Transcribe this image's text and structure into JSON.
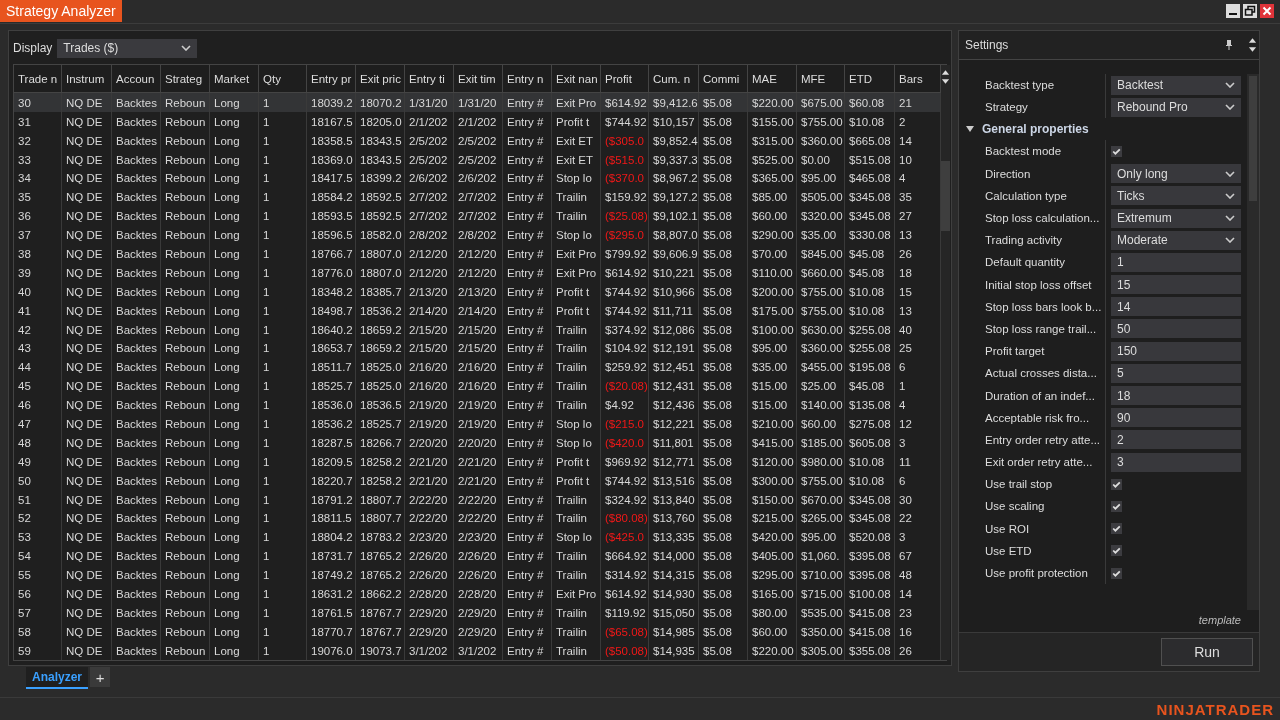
{
  "window": {
    "title": "Strategy Analyzer"
  },
  "display": {
    "label": "Display",
    "value": "Trades ($)"
  },
  "table": {
    "columns": [
      "Trade n",
      "Instrum",
      "Accoun",
      "Strateg",
      "Market",
      "Qty",
      "Entry pr",
      "Exit pric",
      "Entry ti",
      "Exit tim",
      "Entry n",
      "Exit nan",
      "Profit",
      "Cum. n",
      "Commi",
      "MAE",
      "MFE",
      "ETD",
      "Bars"
    ],
    "rows": [
      {
        "selected": true,
        "loss": false,
        "cells": [
          "30",
          "NQ DE",
          "Backtes",
          "Reboun",
          "Long",
          "1",
          "18039.2",
          "18070.2",
          "1/31/20",
          "1/31/20",
          "Entry #",
          "Exit Pro",
          "$614.92",
          "$9,412.6",
          "$5.08",
          "$220.00",
          "$675.00",
          "$60.08",
          "21"
        ]
      },
      {
        "selected": false,
        "loss": false,
        "cells": [
          "31",
          "NQ DE",
          "Backtes",
          "Reboun",
          "Long",
          "1",
          "18167.5",
          "18205.0",
          "2/1/202",
          "2/1/202",
          "Entry #",
          "Profit t",
          "$744.92",
          "$10,157",
          "$5.08",
          "$155.00",
          "$755.00",
          "$10.08",
          "2"
        ]
      },
      {
        "selected": false,
        "loss": true,
        "cells": [
          "32",
          "NQ DE",
          "Backtes",
          "Reboun",
          "Long",
          "1",
          "18358.5",
          "18343.5",
          "2/5/202",
          "2/5/202",
          "Entry #",
          "Exit ET",
          "($305.0",
          "$9,852.4",
          "$5.08",
          "$315.00",
          "$360.00",
          "$665.08",
          "14"
        ]
      },
      {
        "selected": false,
        "loss": true,
        "cells": [
          "33",
          "NQ DE",
          "Backtes",
          "Reboun",
          "Long",
          "1",
          "18369.0",
          "18343.5",
          "2/5/202",
          "2/5/202",
          "Entry #",
          "Exit ET",
          "($515.0",
          "$9,337.3",
          "$5.08",
          "$525.00",
          "$0.00",
          "$515.08",
          "10"
        ]
      },
      {
        "selected": false,
        "loss": true,
        "cells": [
          "34",
          "NQ DE",
          "Backtes",
          "Reboun",
          "Long",
          "1",
          "18417.5",
          "18399.2",
          "2/6/202",
          "2/6/202",
          "Entry #",
          "Stop lo",
          "($370.0",
          "$8,967.2",
          "$5.08",
          "$365.00",
          "$95.00",
          "$465.08",
          "4"
        ]
      },
      {
        "selected": false,
        "loss": false,
        "cells": [
          "35",
          "NQ DE",
          "Backtes",
          "Reboun",
          "Long",
          "1",
          "18584.2",
          "18592.5",
          "2/7/202",
          "2/7/202",
          "Entry #",
          "Trailin",
          "$159.92",
          "$9,127.2",
          "$5.08",
          "$85.00",
          "$505.00",
          "$345.08",
          "35"
        ]
      },
      {
        "selected": false,
        "loss": true,
        "cells": [
          "36",
          "NQ DE",
          "Backtes",
          "Reboun",
          "Long",
          "1",
          "18593.5",
          "18592.5",
          "2/7/202",
          "2/7/202",
          "Entry #",
          "Trailin",
          "($25.08)",
          "$9,102.1",
          "$5.08",
          "$60.00",
          "$320.00",
          "$345.08",
          "27"
        ]
      },
      {
        "selected": false,
        "loss": true,
        "cells": [
          "37",
          "NQ DE",
          "Backtes",
          "Reboun",
          "Long",
          "1",
          "18596.5",
          "18582.0",
          "2/8/202",
          "2/8/202",
          "Entry #",
          "Stop lo",
          "($295.0",
          "$8,807.0",
          "$5.08",
          "$290.00",
          "$35.00",
          "$330.08",
          "13"
        ]
      },
      {
        "selected": false,
        "loss": false,
        "cells": [
          "38",
          "NQ DE",
          "Backtes",
          "Reboun",
          "Long",
          "1",
          "18766.7",
          "18807.0",
          "2/12/20",
          "2/12/20",
          "Entry #",
          "Exit Pro",
          "$799.92",
          "$9,606.9",
          "$5.08",
          "$70.00",
          "$845.00",
          "$45.08",
          "26"
        ]
      },
      {
        "selected": false,
        "loss": false,
        "cells": [
          "39",
          "NQ DE",
          "Backtes",
          "Reboun",
          "Long",
          "1",
          "18776.0",
          "18807.0",
          "2/12/20",
          "2/12/20",
          "Entry #",
          "Exit Pro",
          "$614.92",
          "$10,221",
          "$5.08",
          "$110.00",
          "$660.00",
          "$45.08",
          "18"
        ]
      },
      {
        "selected": false,
        "loss": false,
        "cells": [
          "40",
          "NQ DE",
          "Backtes",
          "Reboun",
          "Long",
          "1",
          "18348.2",
          "18385.7",
          "2/13/20",
          "2/13/20",
          "Entry #",
          "Profit t",
          "$744.92",
          "$10,966",
          "$5.08",
          "$200.00",
          "$755.00",
          "$10.08",
          "15"
        ]
      },
      {
        "selected": false,
        "loss": false,
        "cells": [
          "41",
          "NQ DE",
          "Backtes",
          "Reboun",
          "Long",
          "1",
          "18498.7",
          "18536.2",
          "2/14/20",
          "2/14/20",
          "Entry #",
          "Profit t",
          "$744.92",
          "$11,711",
          "$5.08",
          "$175.00",
          "$755.00",
          "$10.08",
          "13"
        ]
      },
      {
        "selected": false,
        "loss": false,
        "cells": [
          "42",
          "NQ DE",
          "Backtes",
          "Reboun",
          "Long",
          "1",
          "18640.2",
          "18659.2",
          "2/15/20",
          "2/15/20",
          "Entry #",
          "Trailin",
          "$374.92",
          "$12,086",
          "$5.08",
          "$100.00",
          "$630.00",
          "$255.08",
          "40"
        ]
      },
      {
        "selected": false,
        "loss": false,
        "cells": [
          "43",
          "NQ DE",
          "Backtes",
          "Reboun",
          "Long",
          "1",
          "18653.7",
          "18659.2",
          "2/15/20",
          "2/15/20",
          "Entry #",
          "Trailin",
          "$104.92",
          "$12,191",
          "$5.08",
          "$95.00",
          "$360.00",
          "$255.08",
          "25"
        ]
      },
      {
        "selected": false,
        "loss": false,
        "cells": [
          "44",
          "NQ DE",
          "Backtes",
          "Reboun",
          "Long",
          "1",
          "18511.7",
          "18525.0",
          "2/16/20",
          "2/16/20",
          "Entry #",
          "Trailin",
          "$259.92",
          "$12,451",
          "$5.08",
          "$35.00",
          "$455.00",
          "$195.08",
          "6"
        ]
      },
      {
        "selected": false,
        "loss": true,
        "cells": [
          "45",
          "NQ DE",
          "Backtes",
          "Reboun",
          "Long",
          "1",
          "18525.7",
          "18525.0",
          "2/16/20",
          "2/16/20",
          "Entry #",
          "Trailin",
          "($20.08)",
          "$12,431",
          "$5.08",
          "$15.00",
          "$25.00",
          "$45.08",
          "1"
        ]
      },
      {
        "selected": false,
        "loss": false,
        "cells": [
          "46",
          "NQ DE",
          "Backtes",
          "Reboun",
          "Long",
          "1",
          "18536.0",
          "18536.5",
          "2/19/20",
          "2/19/20",
          "Entry #",
          "Trailin",
          "$4.92",
          "$12,436",
          "$5.08",
          "$15.00",
          "$140.00",
          "$135.08",
          "4"
        ]
      },
      {
        "selected": false,
        "loss": true,
        "cells": [
          "47",
          "NQ DE",
          "Backtes",
          "Reboun",
          "Long",
          "1",
          "18536.2",
          "18525.7",
          "2/19/20",
          "2/19/20",
          "Entry #",
          "Stop lo",
          "($215.0",
          "$12,221",
          "$5.08",
          "$210.00",
          "$60.00",
          "$275.08",
          "12"
        ]
      },
      {
        "selected": false,
        "loss": true,
        "cells": [
          "48",
          "NQ DE",
          "Backtes",
          "Reboun",
          "Long",
          "1",
          "18287.5",
          "18266.7",
          "2/20/20",
          "2/20/20",
          "Entry #",
          "Stop lo",
          "($420.0",
          "$11,801",
          "$5.08",
          "$415.00",
          "$185.00",
          "$605.08",
          "3"
        ]
      },
      {
        "selected": false,
        "loss": false,
        "cells": [
          "49",
          "NQ DE",
          "Backtes",
          "Reboun",
          "Long",
          "1",
          "18209.5",
          "18258.2",
          "2/21/20",
          "2/21/20",
          "Entry #",
          "Profit t",
          "$969.92",
          "$12,771",
          "$5.08",
          "$120.00",
          "$980.00",
          "$10.08",
          "11"
        ]
      },
      {
        "selected": false,
        "loss": false,
        "cells": [
          "50",
          "NQ DE",
          "Backtes",
          "Reboun",
          "Long",
          "1",
          "18220.7",
          "18258.2",
          "2/21/20",
          "2/21/20",
          "Entry #",
          "Profit t",
          "$744.92",
          "$13,516",
          "$5.08",
          "$300.00",
          "$755.00",
          "$10.08",
          "6"
        ]
      },
      {
        "selected": false,
        "loss": false,
        "cells": [
          "51",
          "NQ DE",
          "Backtes",
          "Reboun",
          "Long",
          "1",
          "18791.2",
          "18807.7",
          "2/22/20",
          "2/22/20",
          "Entry #",
          "Trailin",
          "$324.92",
          "$13,840",
          "$5.08",
          "$150.00",
          "$670.00",
          "$345.08",
          "30"
        ]
      },
      {
        "selected": false,
        "loss": true,
        "cells": [
          "52",
          "NQ DE",
          "Backtes",
          "Reboun",
          "Long",
          "1",
          "18811.5",
          "18807.7",
          "2/22/20",
          "2/22/20",
          "Entry #",
          "Trailin",
          "($80.08)",
          "$13,760",
          "$5.08",
          "$215.00",
          "$265.00",
          "$345.08",
          "22"
        ]
      },
      {
        "selected": false,
        "loss": true,
        "cells": [
          "53",
          "NQ DE",
          "Backtes",
          "Reboun",
          "Long",
          "1",
          "18804.2",
          "18783.2",
          "2/23/20",
          "2/23/20",
          "Entry #",
          "Stop lo",
          "($425.0",
          "$13,335",
          "$5.08",
          "$420.00",
          "$95.00",
          "$520.08",
          "3"
        ]
      },
      {
        "selected": false,
        "loss": false,
        "cells": [
          "54",
          "NQ DE",
          "Backtes",
          "Reboun",
          "Long",
          "1",
          "18731.7",
          "18765.2",
          "2/26/20",
          "2/26/20",
          "Entry #",
          "Trailin",
          "$664.92",
          "$14,000",
          "$5.08",
          "$405.00",
          "$1,060.",
          "$395.08",
          "67"
        ]
      },
      {
        "selected": false,
        "loss": false,
        "cells": [
          "55",
          "NQ DE",
          "Backtes",
          "Reboun",
          "Long",
          "1",
          "18749.2",
          "18765.2",
          "2/26/20",
          "2/26/20",
          "Entry #",
          "Trailin",
          "$314.92",
          "$14,315",
          "$5.08",
          "$295.00",
          "$710.00",
          "$395.08",
          "48"
        ]
      },
      {
        "selected": false,
        "loss": false,
        "cells": [
          "56",
          "NQ DE",
          "Backtes",
          "Reboun",
          "Long",
          "1",
          "18631.2",
          "18662.2",
          "2/28/20",
          "2/28/20",
          "Entry #",
          "Exit Pro",
          "$614.92",
          "$14,930",
          "$5.08",
          "$165.00",
          "$715.00",
          "$100.08",
          "14"
        ]
      },
      {
        "selected": false,
        "loss": false,
        "cells": [
          "57",
          "NQ DE",
          "Backtes",
          "Reboun",
          "Long",
          "1",
          "18761.5",
          "18767.7",
          "2/29/20",
          "2/29/20",
          "Entry #",
          "Trailin",
          "$119.92",
          "$15,050",
          "$5.08",
          "$80.00",
          "$535.00",
          "$415.08",
          "23"
        ]
      },
      {
        "selected": false,
        "loss": true,
        "cells": [
          "58",
          "NQ DE",
          "Backtes",
          "Reboun",
          "Long",
          "1",
          "18770.7",
          "18767.7",
          "2/29/20",
          "2/29/20",
          "Entry #",
          "Trailin",
          "($65.08)",
          "$14,985",
          "$5.08",
          "$60.00",
          "$350.00",
          "$415.08",
          "16"
        ]
      },
      {
        "selected": false,
        "loss": true,
        "cells": [
          "59",
          "NQ DE",
          "Backtes",
          "Reboun",
          "Long",
          "1",
          "19076.0",
          "19073.7",
          "3/1/202",
          "3/1/202",
          "Entry #",
          "Trailin",
          "($50.08)",
          "$14,935",
          "$5.08",
          "$220.00",
          "$305.00",
          "$355.08",
          "26"
        ]
      }
    ]
  },
  "settings": {
    "title": "Settings",
    "items": [
      {
        "kind": "select",
        "label": "Backtest type",
        "value": "Backtest"
      },
      {
        "kind": "select",
        "label": "Strategy",
        "value": "Rebound Pro"
      },
      {
        "kind": "group",
        "label": "General properties",
        "expanded": true
      },
      {
        "kind": "checkbox",
        "label": "Backtest mode",
        "checked": true
      },
      {
        "kind": "select",
        "label": "Direction",
        "value": "Only long"
      },
      {
        "kind": "select",
        "label": "Calculation type",
        "value": "Ticks"
      },
      {
        "kind": "select",
        "label": "Stop loss calculation...",
        "value": "Extremum"
      },
      {
        "kind": "select",
        "label": "Trading activity",
        "value": "Moderate"
      },
      {
        "kind": "number",
        "label": "Default quantity",
        "value": "1"
      },
      {
        "kind": "number",
        "label": "Initial stop loss offset",
        "value": "15"
      },
      {
        "kind": "number",
        "label": "Stop loss bars look b...",
        "value": "14"
      },
      {
        "kind": "number",
        "label": "Stop loss range trail...",
        "value": "50"
      },
      {
        "kind": "number",
        "label": "Profit target",
        "value": "150"
      },
      {
        "kind": "number",
        "label": "Actual crosses dista...",
        "value": "5"
      },
      {
        "kind": "number",
        "label": "Duration of an indef...",
        "value": "18"
      },
      {
        "kind": "number",
        "label": "Acceptable risk fro...",
        "value": "90"
      },
      {
        "kind": "number",
        "label": "Entry order retry atte...",
        "value": "2"
      },
      {
        "kind": "number",
        "label": "Exit order retry atte...",
        "value": "3"
      },
      {
        "kind": "checkbox",
        "label": "Use trail stop",
        "checked": true
      },
      {
        "kind": "checkbox",
        "label": "Use scaling",
        "checked": true
      },
      {
        "kind": "checkbox",
        "label": "Use ROI",
        "checked": true
      },
      {
        "kind": "checkbox",
        "label": "Use ETD",
        "checked": true
      },
      {
        "kind": "checkbox",
        "label": "Use profit protection",
        "checked": true
      }
    ],
    "template": "template",
    "run_button": "Run"
  },
  "bottom_tabs": [
    {
      "label": "Analyzer",
      "selected": true
    }
  ],
  "add_tab": "+",
  "logo": "NINJATRADER"
}
